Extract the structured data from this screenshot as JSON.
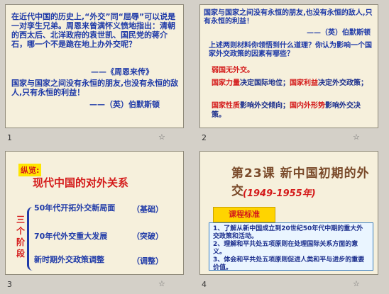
{
  "slides": [
    {
      "number": "1",
      "paragraph1": "在近代中国的历史上,“外交”同“屈辱”可以说是一对孪生兄弟。周恩来曾满怀义愤地指出：清朝的西太后、北洋政府的袁世凯、国民党的蒋介石，哪一个不是跪在地上办外交呢？",
      "attribution1": "——《周恩来传》",
      "paragraph2": "国家与国家之间没有永恒的朋友,也没有永恒的敌人,只有永恒的利益！",
      "attribution2": "——（英）伯默斯顿"
    },
    {
      "number": "2",
      "quote": "国家与国家之间没有永恒的朋友,也没有永恒的敌人,只有永恒的利益！",
      "attribution": "——（英）伯默斯顿",
      "question": "上述两则材料你领悟到什么道理？你认为影响一个国家外交政策的因素有哪些？",
      "a1": "弱国无外交。",
      "a2_part1": "国家力量",
      "a2_part2": "决定国际地位；",
      "a2_part3": "国家利益",
      "a2_part4": "决定外交政策；",
      "a3_part1": "国家性质",
      "a3_part2": "影响外交倾向；",
      "a3_part3": "国内外形势",
      "a3_part4": "影响外交决策。"
    },
    {
      "number": "3",
      "banner": "纵览:",
      "title": "现代中国的对外关系",
      "side_label": "三个阶段",
      "items": [
        {
          "label": "50年代开拓外交新局面",
          "tag": "（基础）"
        },
        {
          "label": "70年代外交重大发展",
          "tag": "（突破）"
        },
        {
          "label": "新时期外交政策调整",
          "tag": "（调整）"
        }
      ]
    },
    {
      "number": "4",
      "title": "第23课 新中国初期的外交",
      "years": "(1949-1955年)",
      "badge": "课程标准",
      "standards": [
        "1、了解从新中国成立到20世纪50年代中期的重大外交政策和活动。",
        "2、理解和平共处五项原则在处理国际关系方面的意义。",
        "3、体会和平共处五项原则促进人类和平与进步的重要价值。"
      ]
    }
  ]
}
